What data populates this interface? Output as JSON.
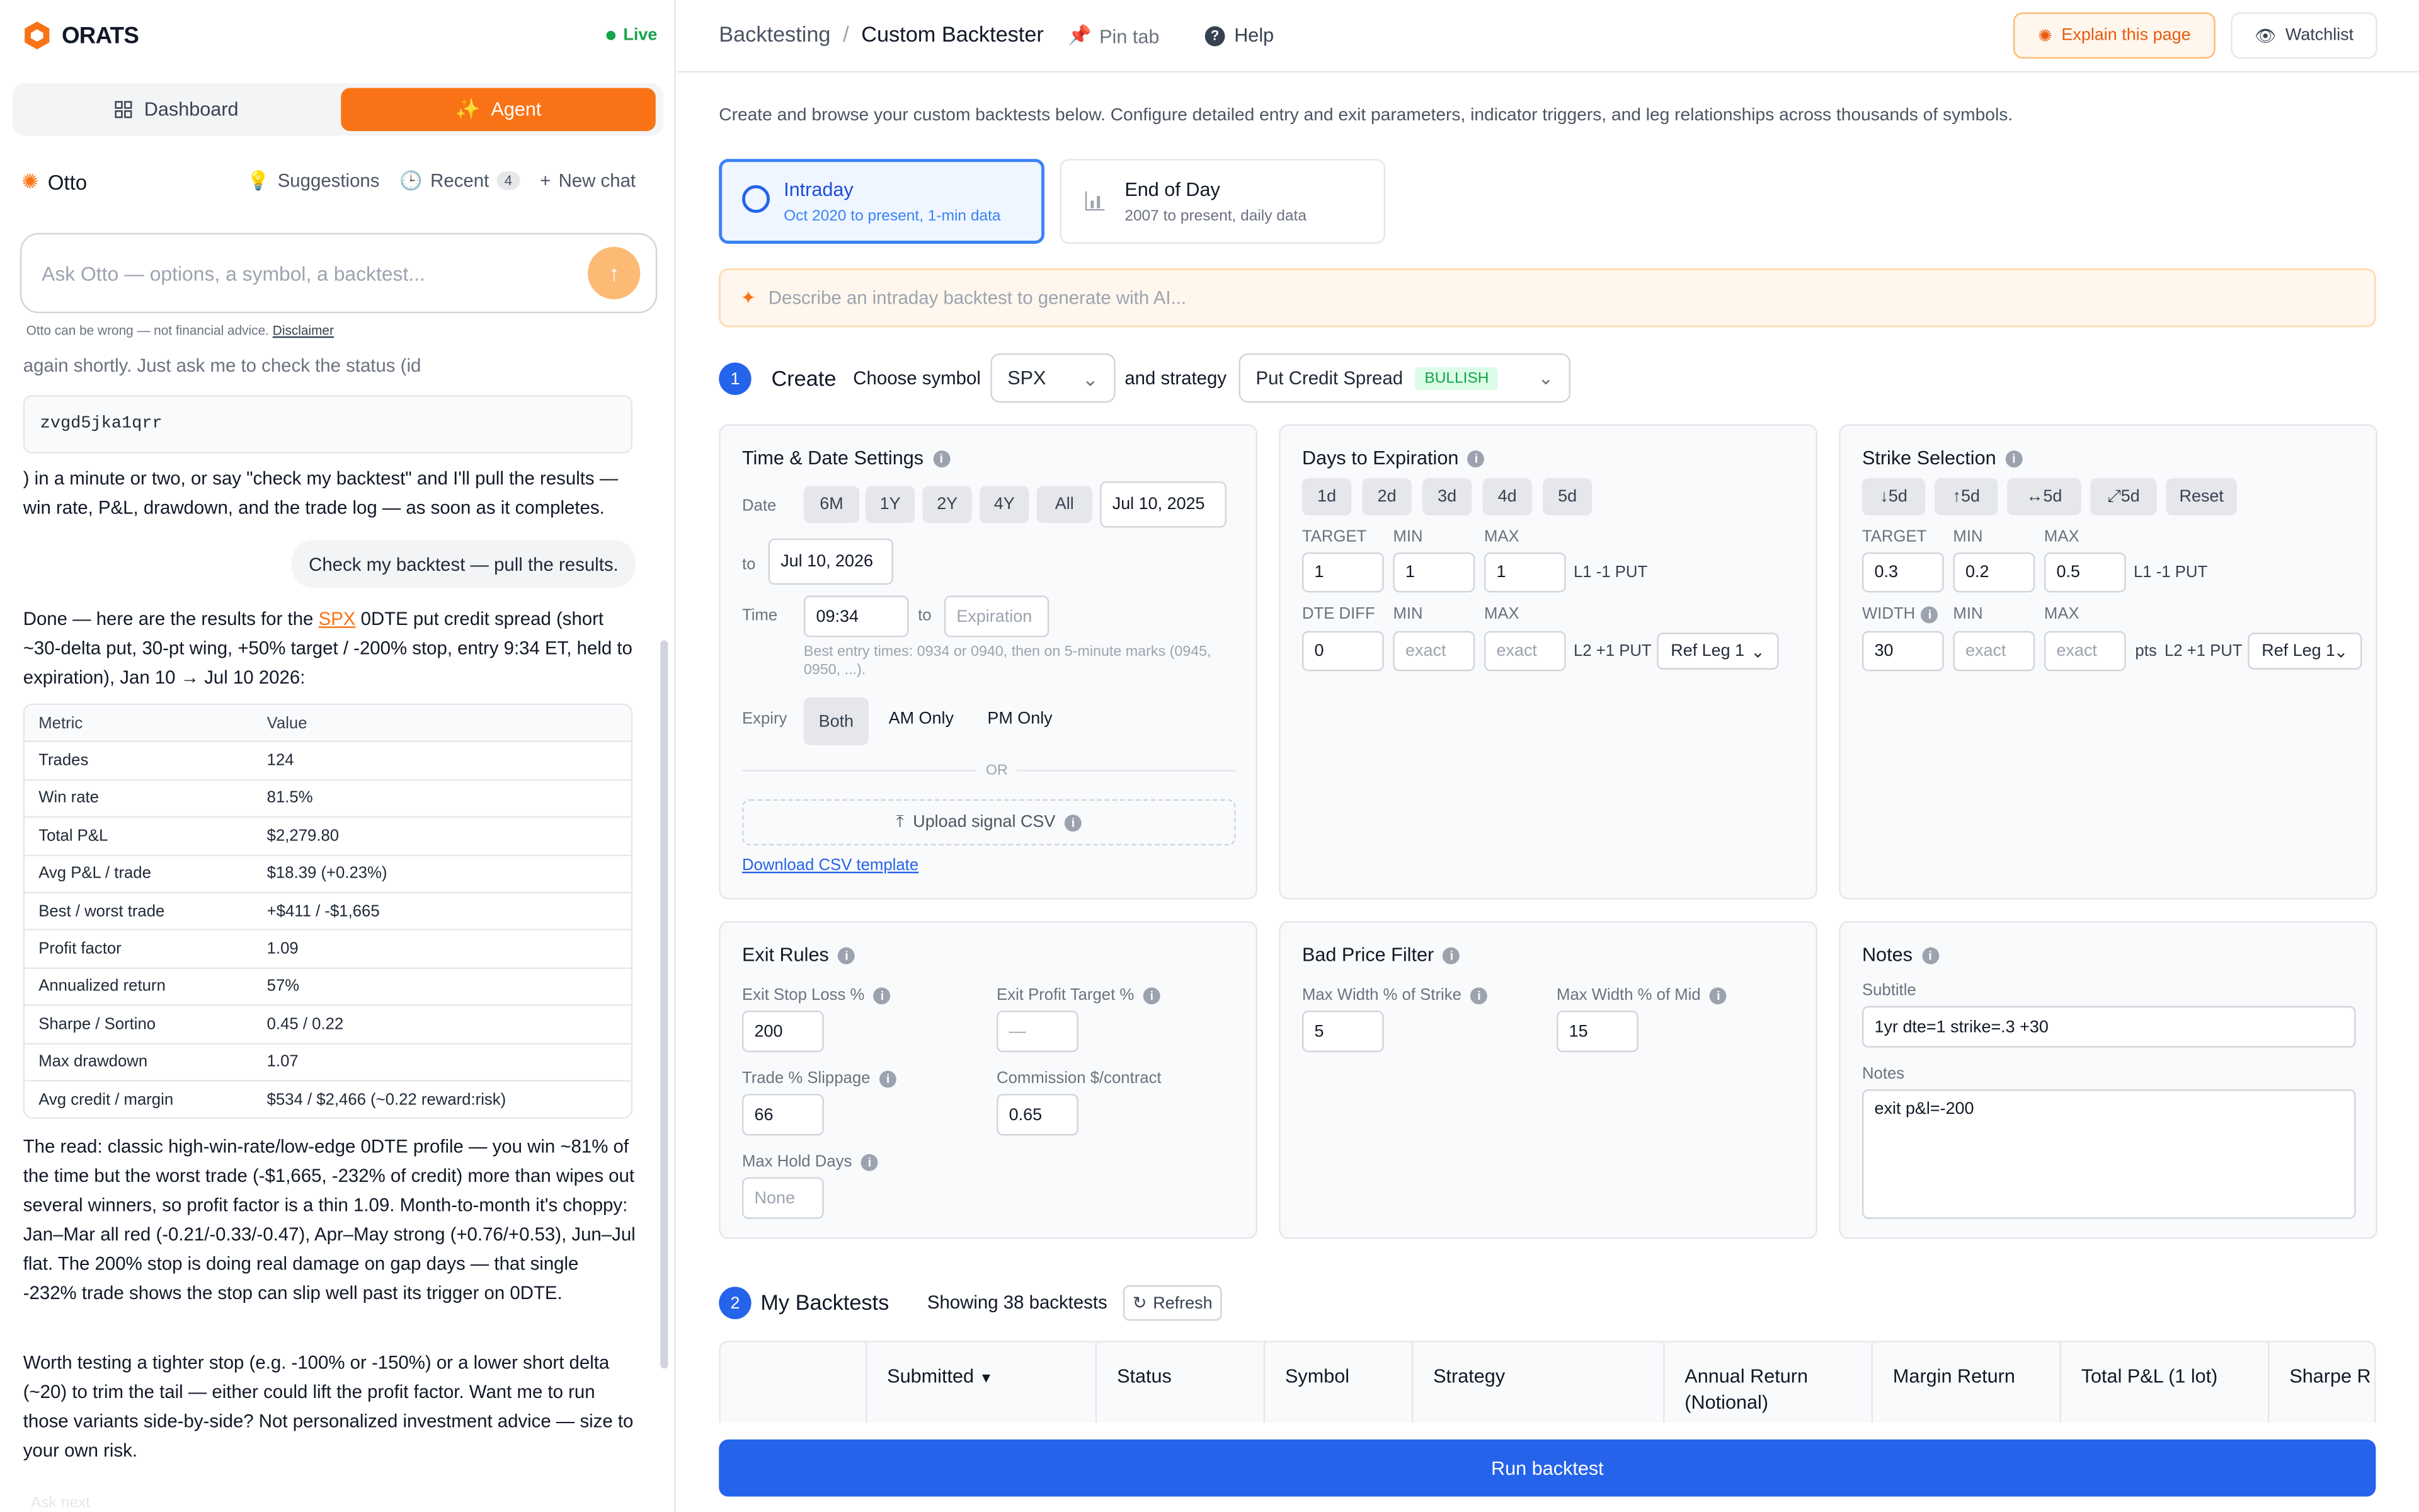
{
  "app": {
    "name": "ORATS",
    "live": "Live"
  },
  "sidebar": {
    "tabs": {
      "dashboard": "Dashboard",
      "agent": "Agent"
    },
    "assistant": {
      "name": "Otto",
      "suggestions": "Suggestions",
      "recent": "Recent",
      "recent_count": "4",
      "new_chat": "New chat"
    },
    "input": {
      "placeholder": "Ask Otto — options, a symbol, a backtest..."
    },
    "disclaimer_prefix": "Otto can be wrong — not financial advice.",
    "disclaimer_link": "Disclaimer",
    "chat": {
      "partial_top": "again shortly. Just ask me to check the status (id",
      "code": "zvgd5jka1qrr",
      "after_code": ") in a minute or two, or say \"check my backtest\" and I'll pull the results — win rate, P&L, drawdown, and the trade log — as soon as it completes.",
      "user_message": "Check my backtest — pull the results.",
      "results_intro_a": "Done — here are the results for the",
      "results_symbol": "SPX",
      "results_intro_b": "0DTE put credit spread (short ~30-delta put, 30-pt wing, +50% target / -200% stop, entry 9:34 ET, held to expiration), Jan 10 → Jul 10 2026:",
      "table_headers": [
        "Metric",
        "Value"
      ],
      "table_rows": [
        [
          "Trades",
          "124"
        ],
        [
          "Win rate",
          "81.5%"
        ],
        [
          "Total P&L",
          "$2,279.80"
        ],
        [
          "Avg P&L / trade",
          "$18.39 (+0.23%)"
        ],
        [
          "Best / worst trade",
          "+$411 / -$1,665"
        ],
        [
          "Profit factor",
          "1.09"
        ],
        [
          "Annualized return",
          "57%"
        ],
        [
          "Sharpe / Sortino",
          "0.45 / 0.22"
        ],
        [
          "Max drawdown",
          "1.07"
        ],
        [
          "Avg credit / margin",
          "$534 / $2,466 (~0.22 reward:risk)"
        ]
      ],
      "read_label": "The read:",
      "read_text": "classic high-win-rate/low-edge 0DTE profile — you win ~81% of the time but the worst trade (-$1,665, -232% of credit) more than wipes out several winners, so profit factor is a thin 1.09. Month-to-month it's choppy: Jan–Mar all red (-0.21/-0.33/-0.47), Apr–May strong (+0.76/+0.53), Jun–Jul flat. The 200% stop is doing real damage on gap days — that single -232% trade shows the stop can slip well past its trigger on 0DTE.",
      "suggestion_text": "Worth testing a tighter stop (e.g. -100% or -150%) or a lower short delta (~20) to trim the tail — either could lift the profit factor. Want me to run those variants side-by-side? Not personalized investment advice — size to your own risk.",
      "partial_bottom": "Ask next"
    }
  },
  "header": {
    "breadcrumb_parent": "Backtesting",
    "breadcrumb_sep": "/",
    "breadcrumb_current": "Custom Backtester",
    "pin_tab": "Pin tab",
    "help": "Help",
    "explain": "Explain this page",
    "watchlist": "Watchlist"
  },
  "intro": "Create and browse your custom backtests below. Configure detailed entry and exit parameters, indicator triggers, and leg relationships across thousands of symbols.",
  "mode": {
    "intraday": {
      "title": "Intraday",
      "sub": "Oct 2020 to present, 1-min data"
    },
    "eod": {
      "title": "End of Day",
      "sub": "2007 to present, daily data"
    }
  },
  "ai_prompt": {
    "placeholder": "Describe an intraday backtest to generate with AI..."
  },
  "create": {
    "step": "1",
    "title": "Create",
    "choose_symbol": "Choose symbol",
    "symbol": "SPX",
    "and_strategy": "and strategy",
    "strategy": "Put Credit Spread",
    "strategy_badge": "BULLISH"
  },
  "time_date": {
    "title": "Time & Date Settings",
    "date_label": "Date",
    "ranges": [
      "6M",
      "1Y",
      "2Y",
      "4Y",
      "All"
    ],
    "date_from": "Jul 10, 2025",
    "to": "to",
    "date_to": "Jul 10, 2026",
    "time_label": "Time",
    "time_from": "09:34",
    "time_to_label": "to",
    "time_to_placeholder": "Expiration",
    "time_hint": "Best entry times: 0934 or 0940, then on 5-minute marks (0945, 0950, ...).",
    "expiry_label": "Expiry",
    "expiry_options": [
      "Both",
      "AM Only",
      "PM Only"
    ],
    "or": "OR",
    "upload": "Upload signal CSV",
    "download": "Download CSV template"
  },
  "dte": {
    "title": "Days to Expiration",
    "presets": [
      "1d",
      "2d",
      "3d",
      "4d",
      "5d"
    ],
    "target_label": "TARGET",
    "min_label": "MIN",
    "max_label": "MAX",
    "target": "1",
    "min": "1",
    "max": "1",
    "leg1": "L1 -1 PUT",
    "diff_label": "DTE DIFF",
    "diff_min_label": "MIN",
    "diff_max_label": "MAX",
    "diff": "0",
    "diff_min_placeholder": "exact",
    "diff_max_placeholder": "exact",
    "leg2": "L2 +1 PUT",
    "ref": "Ref Leg 1"
  },
  "strike": {
    "title": "Strike Selection",
    "presets": [
      "↓5d",
      "↑5d",
      "↔5d",
      "⤢5d",
      "Reset"
    ],
    "target_label": "TARGET",
    "min_label": "MIN",
    "max_label": "MAX",
    "target": "0.3",
    "min": "0.2",
    "max": "0.5",
    "leg1": "L1 -1 PUT",
    "width_label": "WIDTH",
    "wmin_label": "MIN",
    "wmax_label": "MAX",
    "width": "30",
    "wmin_placeholder": "exact",
    "wmax_placeholder": "exact",
    "pts": "pts",
    "leg2": "L2 +1 PUT",
    "ref": "Ref Leg 1"
  },
  "exit": {
    "title": "Exit Rules",
    "stop_label": "Exit Stop Loss %",
    "stop": "200",
    "profit_label": "Exit Profit Target %",
    "profit_placeholder": "—",
    "slippage_label": "Trade % Slippage",
    "slippage": "66",
    "commission_label": "Commission $/contract",
    "commission": "0.65",
    "hold_label": "Max Hold Days",
    "hold_placeholder": "None"
  },
  "bad_price": {
    "title": "Bad Price Filter",
    "strike_label": "Max Width % of Strike",
    "strike": "5",
    "mid_label": "Max Width % of Mid",
    "mid": "15"
  },
  "notes": {
    "title": "Notes",
    "subtitle_label": "Subtitle",
    "subtitle": "1yr dte=1 strike=.3 +30",
    "notes_label": "Notes",
    "notes": "exit p&l=-200"
  },
  "backtests": {
    "step": "2",
    "title": "My Backtests",
    "showing": "Showing 38 backtests",
    "refresh": "Refresh",
    "columns": [
      "Submitted",
      "Status",
      "Symbol",
      "Strategy",
      "Annual Return (Notional)",
      "Margin Return",
      "Total P&L (1 lot)",
      "Sharpe R"
    ]
  },
  "run": "Run backtest",
  "colors": {
    "accent": "#f97316",
    "primary": "#2563eb",
    "success": "#16a34a"
  }
}
